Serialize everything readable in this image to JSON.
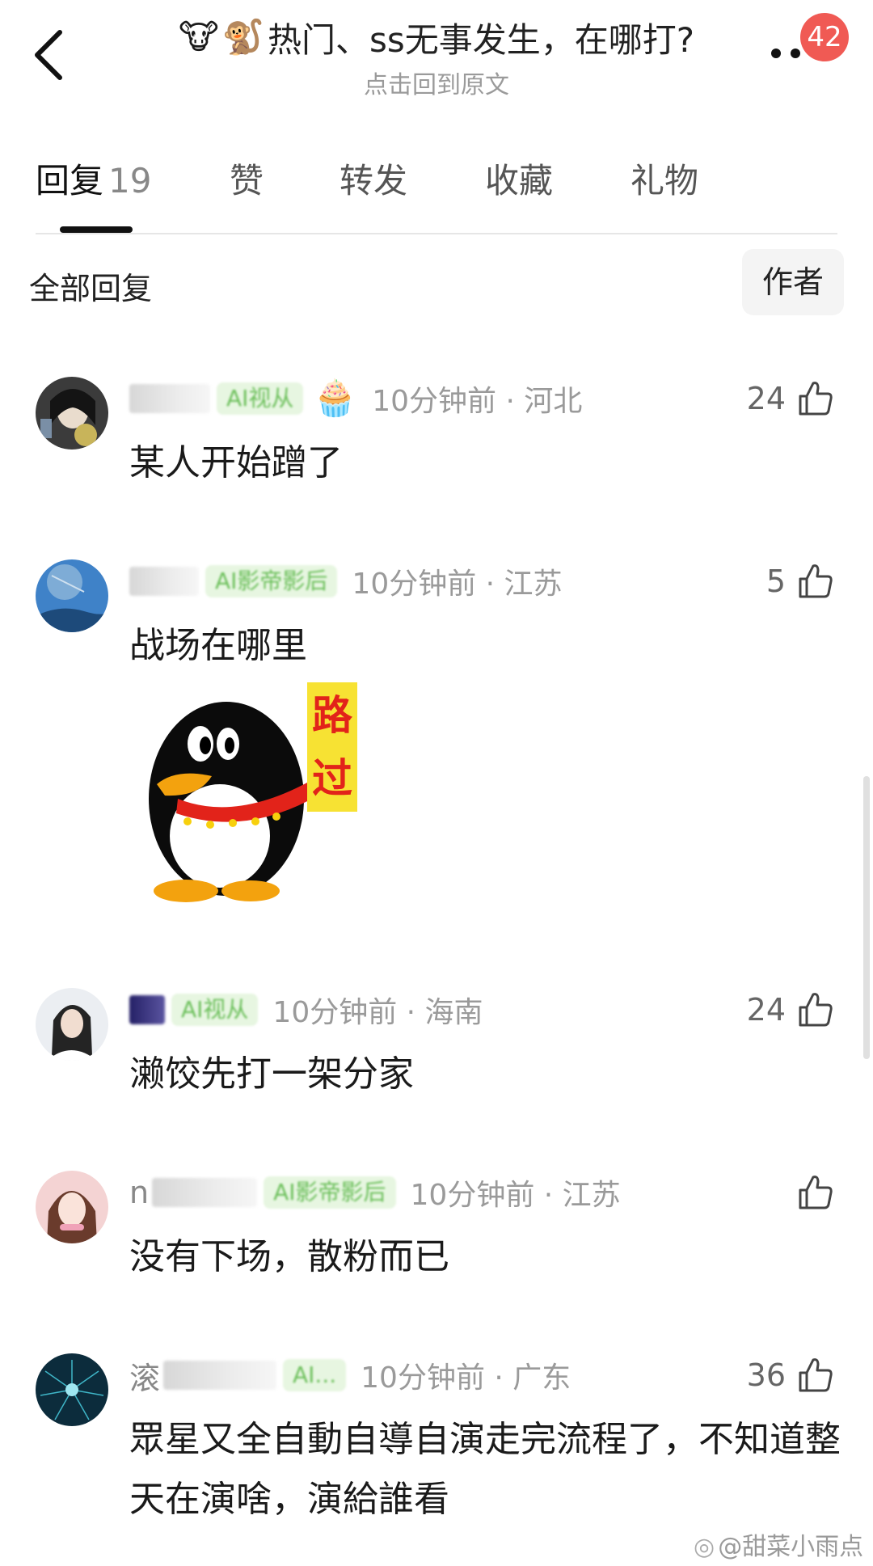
{
  "header": {
    "emoji_1": "🐮",
    "emoji_2": "🐒",
    "title": "热门、ss无事发生，在哪打?",
    "subtitle": "点击回到原文",
    "notification_count": "42"
  },
  "tabs": [
    {
      "label": "回复",
      "count": "19",
      "active": true
    },
    {
      "label": "赞",
      "active": false
    },
    {
      "label": "转发",
      "active": false
    },
    {
      "label": "收藏",
      "active": false
    },
    {
      "label": "礼物",
      "active": false
    }
  ],
  "filter": {
    "label": "全部回复",
    "author_button": "作者"
  },
  "comments": [
    {
      "name_initial": "",
      "medal": "AI视从",
      "badge_icon": "🧁",
      "time_location": "10分钟前 · 河北",
      "likes": "24",
      "text": "某人开始蹭了"
    },
    {
      "name_initial": "",
      "medal": "AI影帝影后",
      "time_location": "10分钟前 · 江苏",
      "likes": "5",
      "text": "战场在哪里",
      "sticker_text": "路过"
    },
    {
      "name_initial": "",
      "medal": "AI视从",
      "time_location": "10分钟前 · 海南",
      "likes": "24",
      "text": "濑饺先打一架分家"
    },
    {
      "name_initial": "n",
      "medal": "AI影帝影后",
      "time_location": "10分钟前 · 江苏",
      "likes": "",
      "text": "没有下场，散粉而已"
    },
    {
      "name_initial": "滚",
      "medal": "AI...",
      "time_location": "10分钟前 · 广东",
      "likes": "36",
      "text": "眾星又全自動自導自演走完流程了，不知道整天在演啥，演給誰看"
    }
  ],
  "watermark": "@甜菜小雨点",
  "colors": {
    "badge": "#f05a54",
    "medal_bg": "#e7f6e1",
    "medal_text": "#6bbf5a",
    "meta_gray": "#9a9a9a"
  }
}
